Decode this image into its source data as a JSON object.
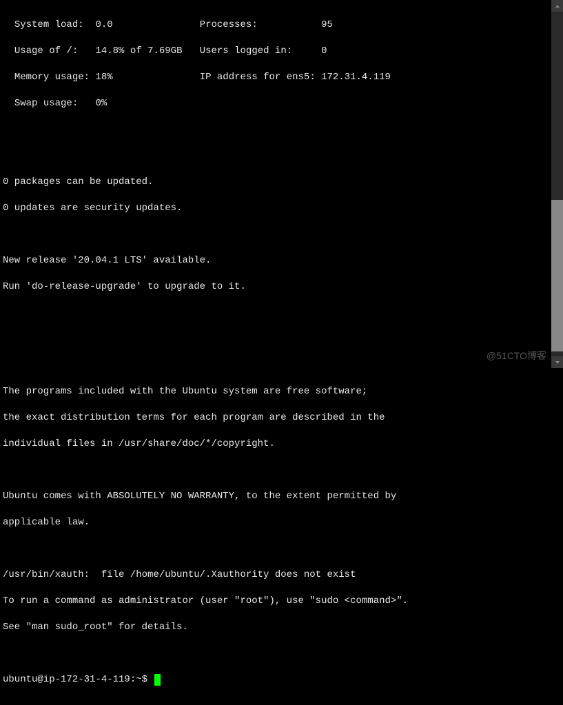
{
  "stats": {
    "system_load_label": "System load:",
    "system_load_value": "0.0",
    "processes_label": "Processes:",
    "processes_value": "95",
    "usage_label": "Usage of /:",
    "usage_value": "14.8% of 7.69GB",
    "users_label": "Users logged in:",
    "users_value": "0",
    "memory_label": "Memory usage:",
    "memory_value": "18%",
    "ip_label": "IP address for ens5:",
    "ip_value": "172.31.4.119",
    "swap_label": "Swap usage:",
    "swap_value": "0%"
  },
  "updates": {
    "packages": "0 packages can be updated.",
    "security": "0 updates are security updates."
  },
  "release": {
    "line1": "New release '20.04.1 LTS' available.",
    "line2": "Run 'do-release-upgrade' to upgrade to it."
  },
  "legal": {
    "line1": "The programs included with the Ubuntu system are free software;",
    "line2": "the exact distribution terms for each program are described in the",
    "line3": "individual files in /usr/share/doc/*/copyright.",
    "line4": "Ubuntu comes with ABSOLUTELY NO WARRANTY, to the extent permitted by",
    "line5": "applicable law."
  },
  "xauth": {
    "line1": "/usr/bin/xauth:  file /home/ubuntu/.Xauthority does not exist",
    "line2": "To run a command as administrator (user \"root\"), use \"sudo <command>\".",
    "line3": "See \"man sudo_root\" for details."
  },
  "prompt": "ubuntu@ip-172-31-4-119:~$ ",
  "watermark": "@51CTO博客"
}
